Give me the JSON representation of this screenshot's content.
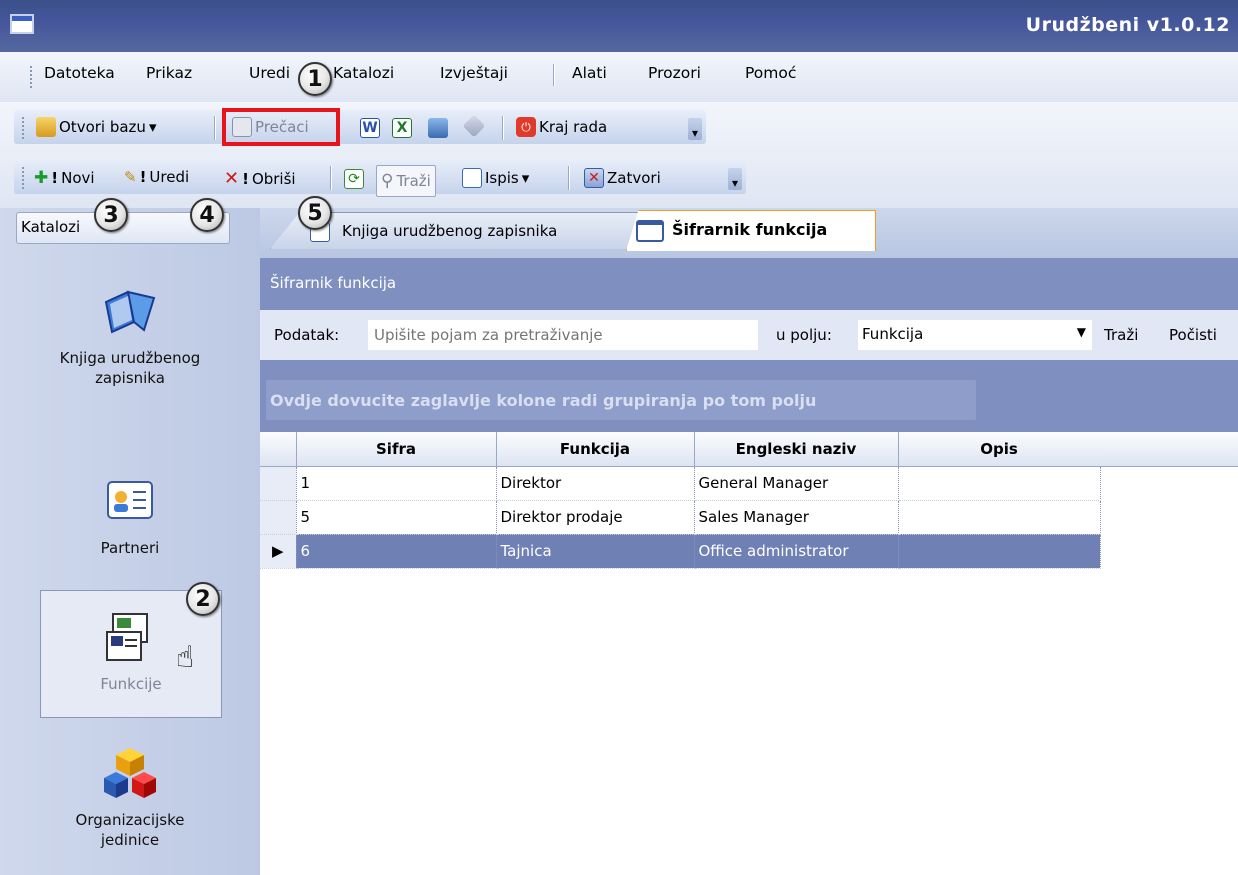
{
  "window": {
    "title": "Urudžbeni v1.0.12"
  },
  "menu": [
    "Datoteka",
    "Prikaz",
    "Uredi",
    "Katalozi",
    "Izvještaji",
    "Alati",
    "Prozori",
    "Pomoć"
  ],
  "toolbar1": {
    "open_db": "Otvori bazu",
    "shortcuts": "Prečaci",
    "exit": "Kraj rada"
  },
  "toolbar2": {
    "new": "Novi",
    "edit": "Uredi",
    "delete": "Obriši",
    "search": "Traži",
    "print": "Ispis",
    "close": "Zatvori"
  },
  "callouts": [
    "1",
    "2",
    "3",
    "4",
    "5"
  ],
  "sidebar": {
    "header": "Katalozi",
    "items": [
      {
        "label": "Knjiga urudžbenog zapisnika"
      },
      {
        "label": "Partneri"
      },
      {
        "label": "Funkcije"
      },
      {
        "label": "Organizacijske jedinice"
      }
    ]
  },
  "tabs": [
    {
      "label": "Knjiga urudžbenog zapisnika"
    },
    {
      "label": "Šifrarnik funkcija"
    }
  ],
  "panel": {
    "title": "Šifrarnik funkcija"
  },
  "search": {
    "label": "Podatak:",
    "placeholder": "Upišite pojam za pretraživanje",
    "field_label": "u polju:",
    "field_value": "Funkcija",
    "search_btn": "Traži",
    "clear_btn": "Počisti"
  },
  "group_hint": "Ovdje dovucite zaglavlje kolone radi grupiranja po tom polju",
  "grid": {
    "columns": [
      "Sifra",
      "Funkcija",
      "Engleski naziv",
      "Opis"
    ],
    "rows": [
      [
        "1",
        "Direktor",
        "General Manager",
        ""
      ],
      [
        "5",
        "Direktor prodaje",
        "Sales Manager",
        ""
      ],
      [
        "6",
        "Tajnica",
        "Office administrator",
        ""
      ]
    ],
    "selected_row": 3
  },
  "colors": {
    "accent": "#7f8fc0",
    "highlight": "#e8141c",
    "titlebar": "#44569a"
  }
}
